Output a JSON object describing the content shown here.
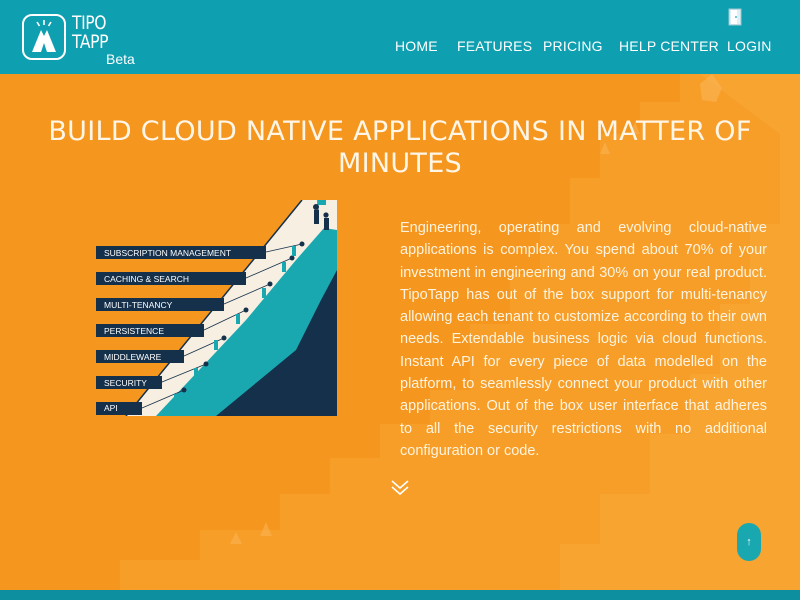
{
  "header": {
    "brand_line1": "TIPO",
    "brand_line2": "TAPP",
    "brand_suffix": "Beta",
    "nav": [
      {
        "label": "HOME"
      },
      {
        "label": "FEATURES"
      },
      {
        "label": "PRICING"
      },
      {
        "label": "HELP CENTER"
      },
      {
        "label": "LOGIN"
      }
    ]
  },
  "hero": {
    "title_line1": "BUILD CLOUD NATIVE APPLICATIONS IN MATTER OF",
    "title_line2": "MINUTES",
    "description": "Engineering, operating and evolving cloud-native applications is complex. You spend about 70% of your investment in engineering and 30% on your real product. TipoTapp has out of the box support for multi-tenancy allowing each tenant to customize according to their own needs. Extendable business logic via cloud functions. Instant API for every piece of data modelled on the platform, to seamlessly connect your product with other applications. Out of the box user interface that adheres to all the security restrictions with no additional configuration or code.",
    "illustration_labels": [
      "SUBSCRIPTION MANAGEMENT",
      "CACHING & SEARCH",
      "MULTI-TENANCY",
      "PERSISTENCE",
      "MIDDLEWARE",
      "SECURITY",
      "API"
    ],
    "scroll_top_symbol": "↑"
  },
  "colors": {
    "header": "#0e9fb0",
    "hero_background": "#f5961e",
    "navy": "#15304a",
    "teal": "#1aa8b0",
    "cream": "#f6efe2"
  }
}
